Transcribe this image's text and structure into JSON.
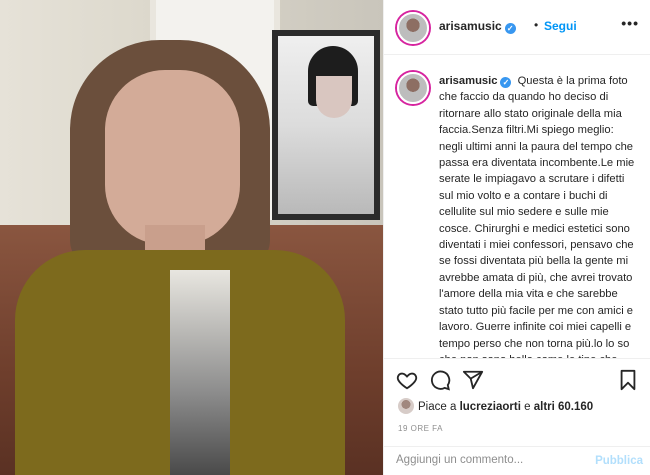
{
  "post": {
    "username": "arisamusic",
    "verified_icon": "verified-badge-icon",
    "dot": "•",
    "follow_label": "Segui",
    "more_label": "•••",
    "caption": "Questa è la prima foto che faccio da quando ho deciso di ritornare allo stato originale della mia faccia.Senza filtri.Mi spiego meglio: negli ultimi anni la paura del tempo che passa era diventata incombente.Le mie serate le impiagavo a scrutare i difetti sul mio volto e a contare i buchi di cellulite sul mio sedere e sulle mie cosce. Chirurghi e medici estetici sono diventati i miei confessori, pensavo che se fossi diventata più bella la gente mi avrebbe amata di più, che avrei trovato l'amore della mia vita e che sarebbe stato tutto più facile per me con amici e lavoro. Guerre infinite coi miei capelli e tempo perso che non torna più.lo lo so che non sono bella come le tipe che vedo sui giornali e",
    "likes_prefix": "Piace a",
    "likes_user": "lucreziaorti",
    "likes_and": "e",
    "likes_others": "altri 60.160",
    "time": "19 ORE FA",
    "comment_placeholder": "Aggiungi un commento...",
    "publish_label": "Pubblica"
  },
  "icons": {
    "like": "heart-icon",
    "comment": "comment-icon",
    "share": "send-icon",
    "save": "bookmark-icon"
  },
  "colors": {
    "accent": "#0095f6",
    "verified": "#3897f0",
    "publish_disabled": "#b2dffc",
    "muted": "#8e8e8e"
  }
}
